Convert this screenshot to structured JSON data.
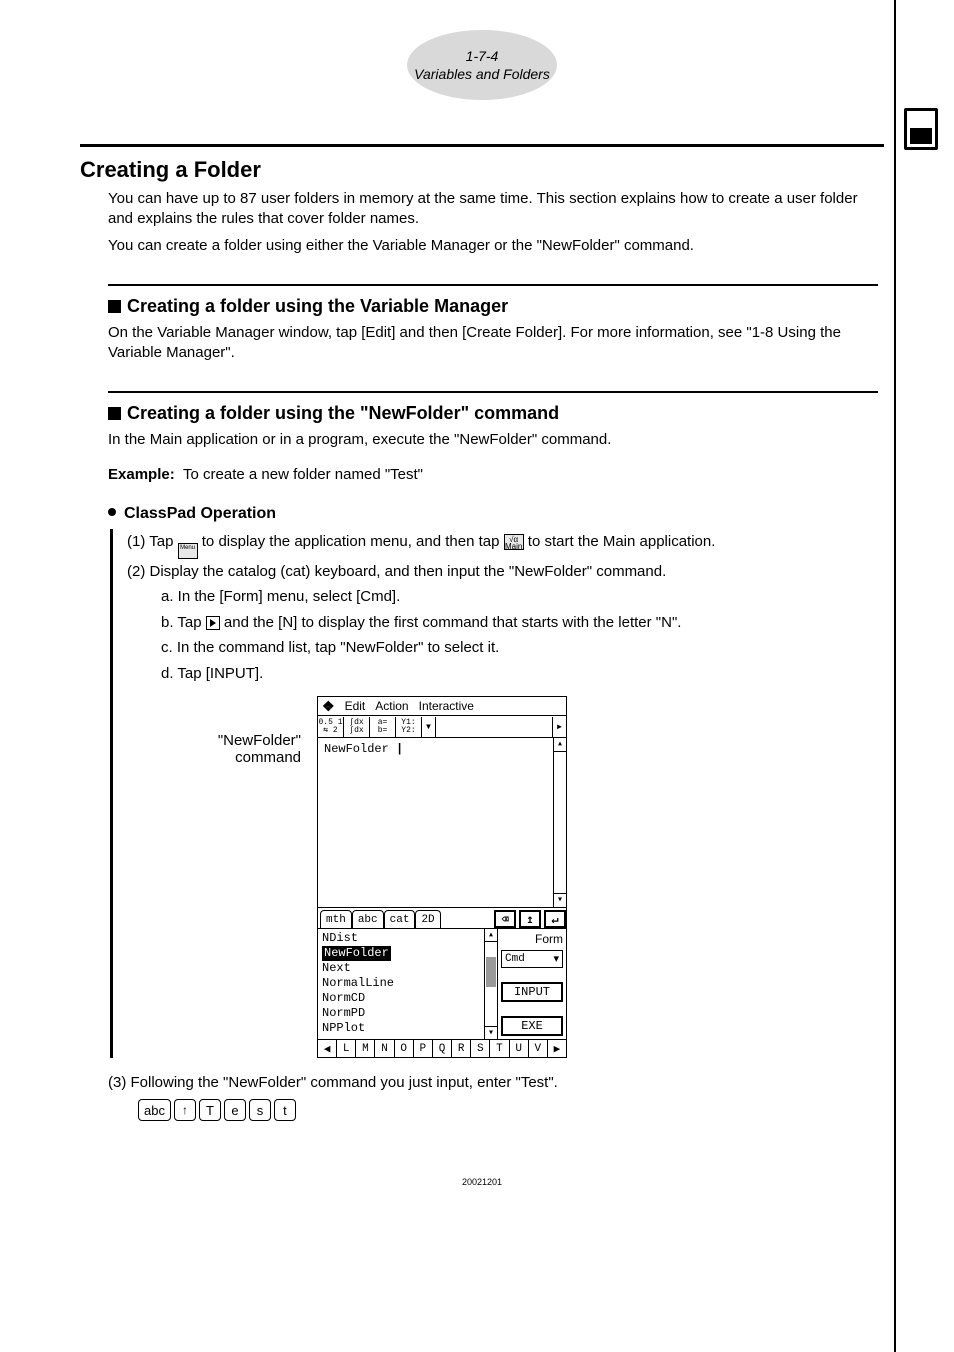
{
  "header": {
    "line1": "1-7-4",
    "line2": "Variables and Folders"
  },
  "h1": "Creating a Folder",
  "intro1": "You can have up to 87 user folders in memory at the same time. This section explains how to create a user folder and explains the rules that cover folder names.",
  "intro2": "You can create a folder using either the Variable Manager or the \"NewFolder\" command.",
  "h2a": "Creating a folder using the Variable Manager",
  "h2a_body": "On the Variable Manager window, tap [Edit] and then [Create Folder]. For more information, see \"1-8 Using the Variable Manager\".",
  "h2b": "Creating a folder using the \"NewFolder\" command",
  "h2b_body": "In the Main application or in a program, execute the \"NewFolder\" command.",
  "example_label": "Example:",
  "example_text": "To create a new folder named \"Test\"",
  "op_head": "ClassPad Operation",
  "step1_pre": "(1) Tap ",
  "step1_mid": " to display the application menu, and then tap ",
  "step1_post": " to start the Main application.",
  "step2": "(2) Display the catalog (cat) keyboard, and then input the \"NewFolder\" command.",
  "sub_a": "a. In the [Form] menu, select [Cmd].",
  "sub_b_pre": "b. Tap ",
  "sub_b_post": " and the [N] to display the first command that starts with the letter \"N\".",
  "sub_c": "c. In the command list, tap \"NewFolder\" to select it.",
  "sub_d": "d. Tap [INPUT].",
  "sshot_label1": "\"NewFolder\"",
  "sshot_label2": "command",
  "device": {
    "menu": {
      "item1": "Edit",
      "item2": "Action",
      "item3": "Interactive"
    },
    "workline": "NewFolder ",
    "tabs": {
      "t1": "mth",
      "t2": "abc",
      "t3": "cat",
      "t4": "2D"
    },
    "list": [
      "NDist",
      "NewFolder",
      "Next",
      "NormalLine",
      "NormCD",
      "NormPD",
      "NPPlot"
    ],
    "form_label": "Form",
    "form_value": "Cmd",
    "btn_input": "INPUT",
    "btn_exe": "EXE",
    "alpha": [
      "◀",
      "L",
      "M",
      "N",
      "O",
      "P",
      "Q",
      "R",
      "S",
      "T",
      "U",
      "V",
      "▶"
    ]
  },
  "step3": "(3) Following the \"NewFolder\" command you just input, enter \"Test\".",
  "keys": [
    "abc",
    "↑",
    "T",
    "e",
    "s",
    "t"
  ],
  "footer": "20021201"
}
